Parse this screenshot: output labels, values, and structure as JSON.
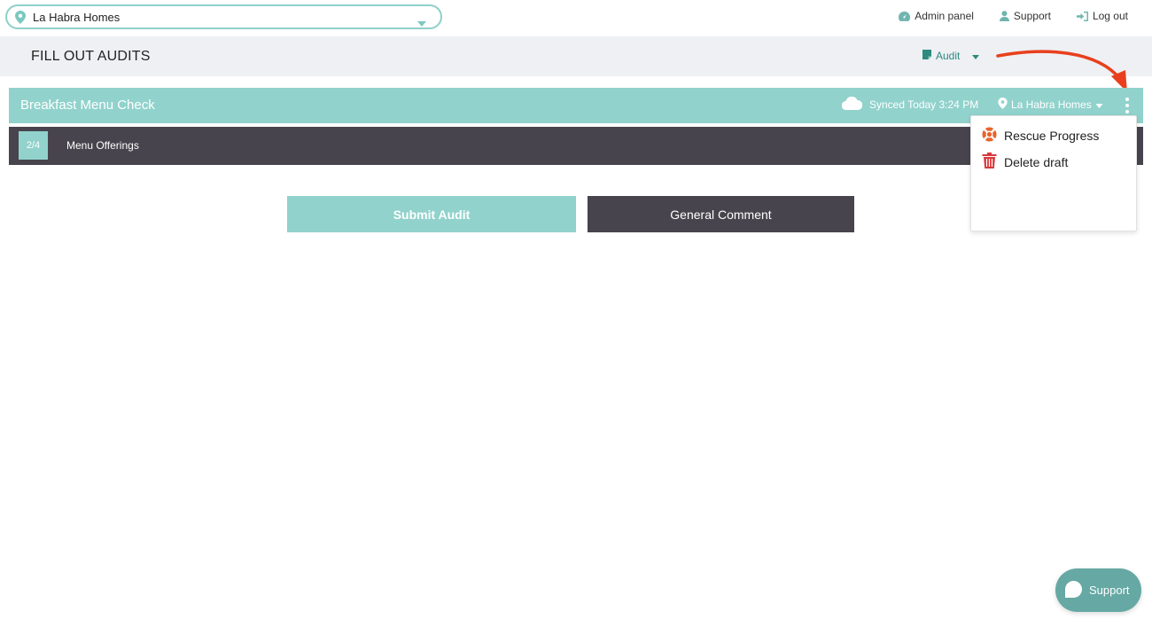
{
  "location_select": {
    "value": "La Habra Homes",
    "icon": "map-pin-icon"
  },
  "top_links": [
    {
      "label": "Admin panel",
      "icon": "dashboard-icon"
    },
    {
      "label": "Support",
      "icon": "user-icon"
    },
    {
      "label": "Log out",
      "icon": "logout-icon"
    }
  ],
  "header": {
    "title": "FILL OUT AUDITS",
    "audit_dropdown": {
      "label": "Audit",
      "icon": "document-icon"
    }
  },
  "audit_banner": {
    "name": "Breakfast Menu Check",
    "sync_status": "Synced Today 3:24 PM",
    "sync_icon": "cloud-icon",
    "location": "La Habra Homes"
  },
  "section": {
    "count": "2/4",
    "name": "Menu Offerings"
  },
  "buttons": {
    "submit": "Submit Audit",
    "comment": "General Comment"
  },
  "menu": {
    "items": [
      {
        "label": "Rescue Progress",
        "icon": "lifebuoy-icon"
      },
      {
        "label": "Delete draft",
        "icon": "trash-icon"
      }
    ]
  },
  "support_chat": {
    "label": "Support",
    "icon": "chat-bubble-icon"
  },
  "colors": {
    "accent": "#91d2cc",
    "accent_border": "#8fd0ca",
    "dark": "#47444d",
    "header_bg": "#eef0f4",
    "link": "#2d8a7e",
    "annotation": "#e8401c",
    "lifebuoy": "#e8632b",
    "trash": "#d8393b",
    "support_bg": "#65a8a4"
  }
}
